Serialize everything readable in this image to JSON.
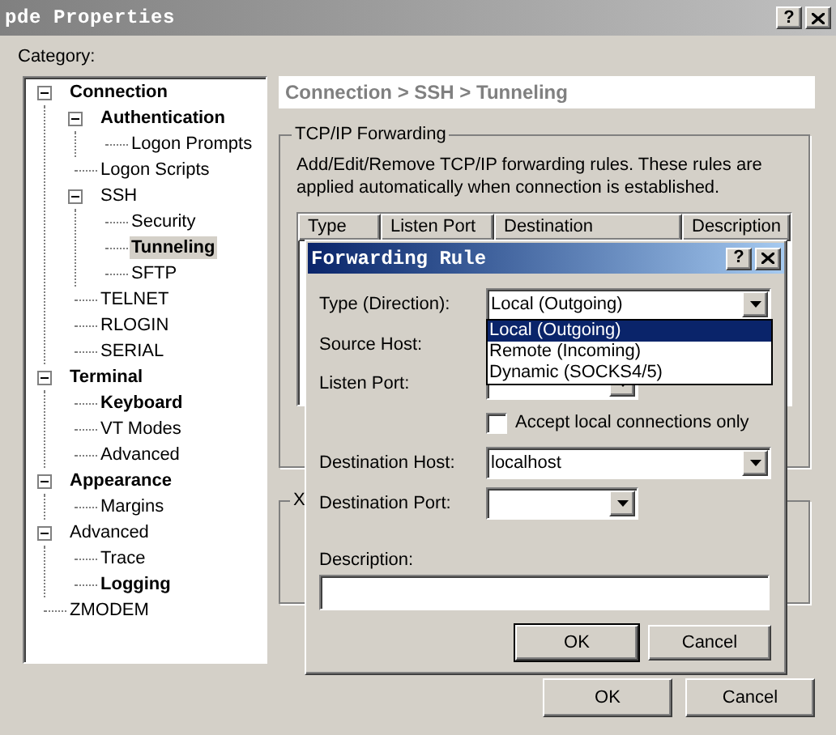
{
  "window": {
    "title": "pde Properties",
    "help_button": "?"
  },
  "category_label": "Category:",
  "tree": [
    {
      "label": "Connection",
      "bold": true,
      "selected": false,
      "expanded": true,
      "children": [
        {
          "label": "Authentication",
          "bold": true,
          "selected": false,
          "expanded": true,
          "children": [
            {
              "label": "Logon Prompts",
              "bold": false,
              "selected": false
            }
          ]
        },
        {
          "label": "Logon Scripts",
          "bold": false,
          "selected": false
        },
        {
          "label": "SSH",
          "bold": false,
          "selected": false,
          "expanded": true,
          "children": [
            {
              "label": "Security",
              "bold": false,
              "selected": false
            },
            {
              "label": "Tunneling",
              "bold": true,
              "selected": true
            },
            {
              "label": "SFTP",
              "bold": false,
              "selected": false
            }
          ]
        },
        {
          "label": "TELNET",
          "bold": false,
          "selected": false
        },
        {
          "label": "RLOGIN",
          "bold": false,
          "selected": false
        },
        {
          "label": "SERIAL",
          "bold": false,
          "selected": false
        }
      ]
    },
    {
      "label": "Terminal",
      "bold": true,
      "selected": false,
      "expanded": true,
      "children": [
        {
          "label": "Keyboard",
          "bold": true,
          "selected": false
        },
        {
          "label": "VT Modes",
          "bold": false,
          "selected": false
        },
        {
          "label": "Advanced",
          "bold": false,
          "selected": false
        }
      ]
    },
    {
      "label": "Appearance",
      "bold": true,
      "selected": false,
      "expanded": true,
      "children": [
        {
          "label": "Margins",
          "bold": false,
          "selected": false
        }
      ]
    },
    {
      "label": "Advanced",
      "bold": false,
      "selected": false,
      "expanded": true,
      "children": [
        {
          "label": "Trace",
          "bold": false,
          "selected": false
        },
        {
          "label": "Logging",
          "bold": true,
          "selected": false
        }
      ]
    },
    {
      "label": "ZMODEM",
      "bold": false,
      "selected": false
    }
  ],
  "breadcrumb": "Connection > SSH > Tunneling",
  "tcp_forwarding": {
    "title": "TCP/IP Forwarding",
    "description": "Add/Edit/Remove TCP/IP forwarding rules. These rules are applied automatically when connection is established.",
    "table": {
      "columns": [
        "Type",
        "Listen Port",
        "Destination",
        "Description"
      ]
    }
  },
  "group_2": {
    "title": "X"
  },
  "buttons": [
    "OK",
    "Cancel"
  ],
  "forwarding_rule": {
    "title": "Forwarding Rule",
    "help_button": "?",
    "type_label": "Type (Direction):",
    "type_value": "Local (Outgoing)",
    "type_options": [
      {
        "label": "Local (Outgoing)",
        "selected": true
      },
      {
        "label": "Remote (Incoming)",
        "selected": false
      },
      {
        "label": "Dynamic (SOCKS4/5)",
        "selected": false
      }
    ],
    "source_host_label": "Source Host:",
    "listen_port_label": "Listen Port:",
    "accept_local": {
      "label": "Accept local connections only",
      "checked": false
    },
    "destination_host_label": "Destination Host:",
    "destination_host_value": "localhost",
    "destination_port_label": "Destination Port:",
    "description_label": "Description:",
    "buttons": [
      "OK",
      "Cancel"
    ]
  }
}
